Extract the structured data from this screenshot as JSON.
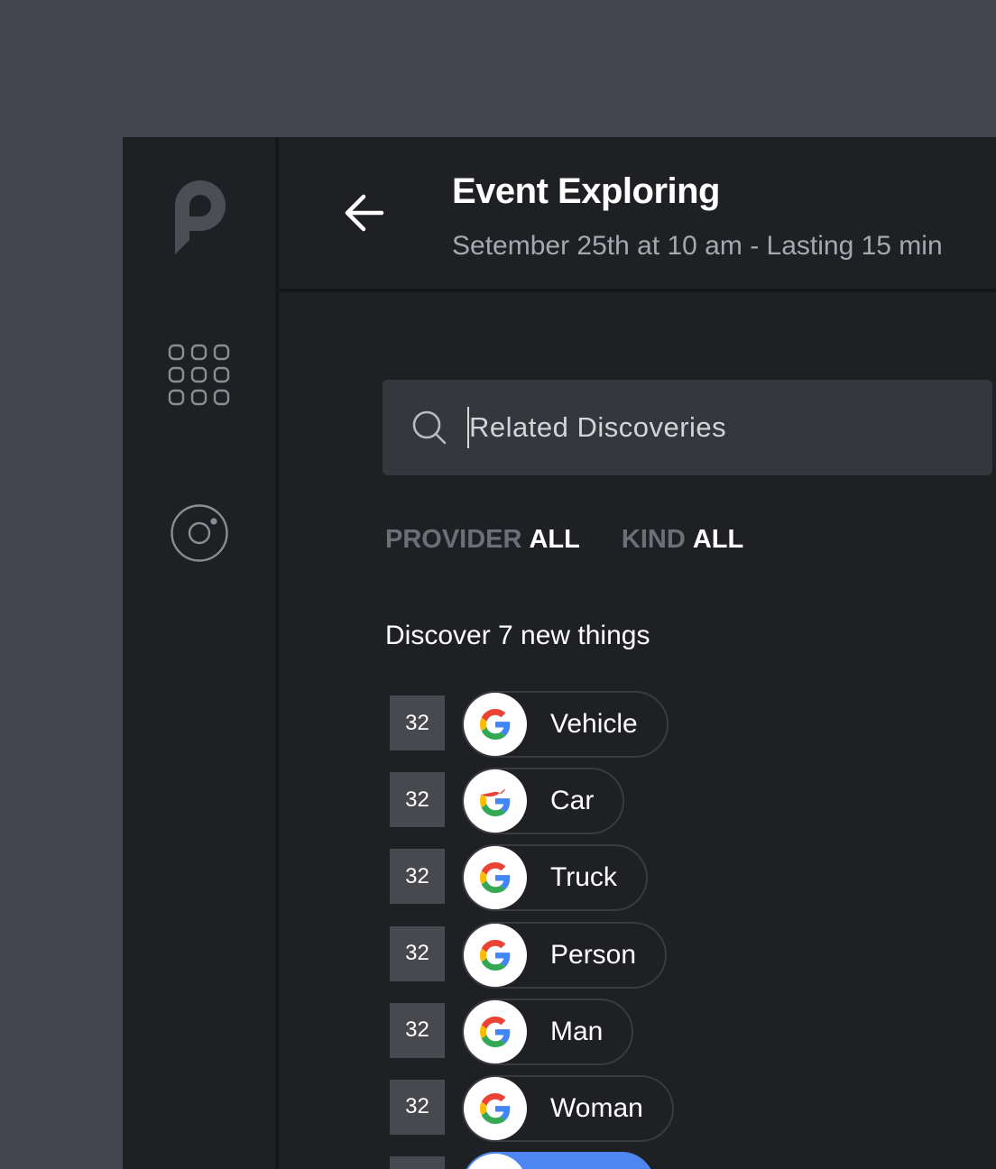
{
  "header": {
    "title": "Event Exploring",
    "subtitle": "Setember 25th at 10 am - Lasting 15 min"
  },
  "search": {
    "placeholder": "Related Discoveries",
    "value": ""
  },
  "filters": [
    {
      "key": "PROVIDER",
      "value": "ALL"
    },
    {
      "key": "KIND",
      "value": "ALL"
    }
  ],
  "discover_heading": "Discover 7 new things",
  "discoveries": [
    {
      "count": "32",
      "label": "Vehicle",
      "provider_icon": "google-icon"
    },
    {
      "count": "32",
      "label": "Car",
      "provider_icon": "google-icon"
    },
    {
      "count": "32",
      "label": "Truck",
      "provider_icon": "google-icon"
    },
    {
      "count": "32",
      "label": "Person",
      "provider_icon": "google-icon"
    },
    {
      "count": "32",
      "label": "Man",
      "provider_icon": "google-icon"
    },
    {
      "count": "32",
      "label": "Woman",
      "provider_icon": "google-icon"
    },
    {
      "count": "",
      "label": "",
      "provider_icon": "google-icon",
      "highlighted": true
    }
  ],
  "sidebar": {
    "icons": [
      "logo-icon",
      "apps-grid-icon",
      "target-icon"
    ]
  },
  "colors": {
    "accent": "#4d86f0",
    "background": "#1f2024",
    "page": "#43464e"
  }
}
